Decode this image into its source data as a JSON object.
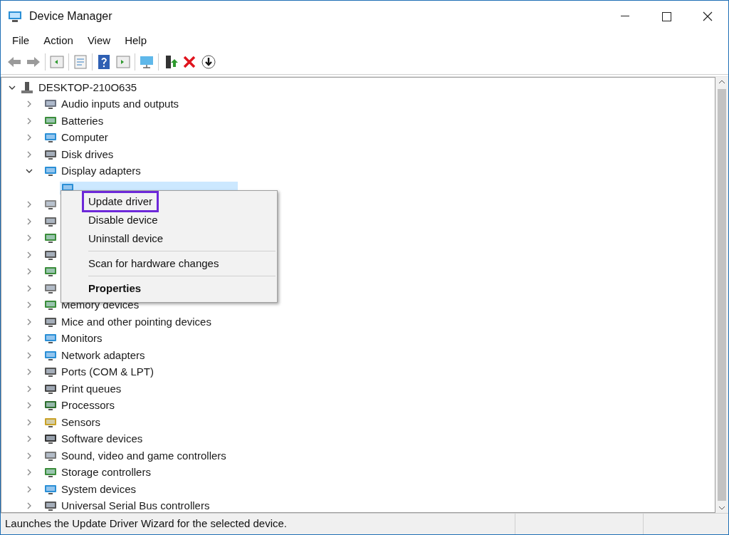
{
  "window": {
    "title": "Device Manager"
  },
  "menu_bar": [
    "File",
    "Action",
    "View",
    "Help"
  ],
  "tree": {
    "label": "DESKTOP-210O635",
    "expanded": true,
    "children": [
      {
        "label": "Audio inputs and outputs",
        "expanded": false
      },
      {
        "label": "Batteries",
        "expanded": false
      },
      {
        "label": "Computer",
        "expanded": false
      },
      {
        "label": "Disk drives",
        "expanded": false
      },
      {
        "label": "Display adapters",
        "expanded": true,
        "children": [
          {
            "selected": true
          }
        ]
      },
      {
        "expanded": false
      },
      {
        "expanded": false
      },
      {
        "expanded": false
      },
      {
        "expanded": false
      },
      {
        "expanded": false
      },
      {
        "expanded": false
      },
      {
        "label": "Memory devices",
        "expanded": false
      },
      {
        "label": "Mice and other pointing devices",
        "expanded": false
      },
      {
        "label": "Monitors",
        "expanded": false
      },
      {
        "label": "Network adapters",
        "expanded": false
      },
      {
        "label": "Ports (COM & LPT)",
        "expanded": false
      },
      {
        "label": "Print queues",
        "expanded": false
      },
      {
        "label": "Processors",
        "expanded": false
      },
      {
        "label": "Sensors",
        "expanded": false
      },
      {
        "label": "Software devices",
        "expanded": false
      },
      {
        "label": "Sound, video and game controllers",
        "expanded": false
      },
      {
        "label": "Storage controllers",
        "expanded": false
      },
      {
        "label": "System devices",
        "expanded": false
      },
      {
        "label": "Universal Serial Bus controllers",
        "expanded": false
      }
    ]
  },
  "context_menu": [
    {
      "label": "Update driver",
      "kind": "item",
      "highlighted": true
    },
    {
      "label": "Disable device",
      "kind": "item",
      "highlighted": false
    },
    {
      "label": "Uninstall device",
      "kind": "item",
      "highlighted": false
    },
    {
      "kind": "separator"
    },
    {
      "label": "Scan for hardware changes",
      "kind": "item",
      "highlighted": false
    },
    {
      "kind": "separator"
    },
    {
      "label": "Properties",
      "kind": "default",
      "highlighted": false
    }
  ],
  "status_bar": "Launches the Update Driver Wizard for the selected device."
}
